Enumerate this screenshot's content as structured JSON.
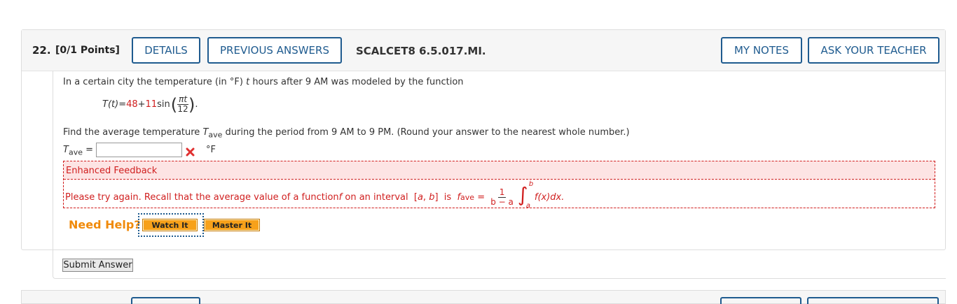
{
  "question": {
    "number": "22.",
    "points": "[0/1 Points]",
    "buttons": {
      "details": "DETAILS",
      "previous_answers": "PREVIOUS ANSWERS",
      "my_notes": "MY NOTES",
      "ask_teacher": "ASK YOUR TEACHER"
    },
    "assignment_code": "SCALCET8 6.5.017.MI."
  },
  "problem": {
    "intro_a": "In a certain city the temperature (in °F) ",
    "intro_var": "t",
    "intro_b": " hours after 9 AM was modeled by the function",
    "func_lhs": "T(t)",
    "eq": " = ",
    "const_a": "48",
    "plus": " + ",
    "const_b": "11",
    "sin": " sin",
    "frac_num": "πt",
    "frac_den": "12",
    "period": ".",
    "find_a": "Find the average temperature ",
    "find_var": "T",
    "find_sub": "ave",
    "find_b": " during the period from 9 AM to 9 PM. (Round your answer to the nearest whole number.)"
  },
  "answer": {
    "label_var": "T",
    "label_sub": "ave",
    "label_eq": " =",
    "value": "",
    "status": "incorrect",
    "unit": "°F"
  },
  "feedback": {
    "title": "Enhanced Feedback",
    "text_a": "Please try again. Recall that the average value of a function ",
    "text_f": "f",
    "text_b": " on an interval  [",
    "text_a2": "a",
    "text_comma": ", ",
    "text_b2": "b",
    "text_c": "]  is  ",
    "fave_f": "f",
    "fave_sub": "ave",
    "fave_eq": " = ",
    "frac_num": "1",
    "frac_den": "b − a",
    "int_upper": "b",
    "int_lower": "a",
    "integrand": "f(x)dx."
  },
  "help": {
    "label": "Need Help?",
    "watch": "Watch It",
    "master": "Master It"
  },
  "submit_label": "Submit Answer",
  "colors": {
    "accent": "#1f5b8f",
    "error": "#d01f1f",
    "help": "#f08a0a"
  }
}
